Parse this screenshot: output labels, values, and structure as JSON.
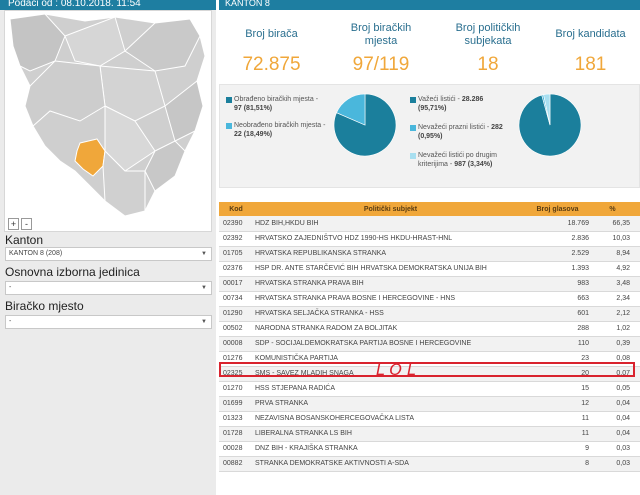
{
  "left_panel": {
    "header": "Podaci od : 08.10.2018. 11:54",
    "zoom_in": "+",
    "zoom_out": "-",
    "kanton_label": "Kanton",
    "kanton_value": "KANTON 8 (208)",
    "jedinica_label": "Osnovna izborna jedinica",
    "jedinica_value": "-",
    "mjesto_label": "Biračko mjesto",
    "mjesto_value": "-"
  },
  "right_panel": {
    "header": "KANTON 8",
    "stats": [
      {
        "label": "Broj birača",
        "value": "72.875"
      },
      {
        "label": "Broj biračkih mjesta",
        "value": "97/119"
      },
      {
        "label": "Broj političkih subjekata",
        "value": "18"
      },
      {
        "label": "Broj kandidata",
        "value": "181"
      }
    ],
    "pie1": {
      "legend": [
        {
          "label": "Obrađeno biračkih mjesta -",
          "value": "97 (81,51%)",
          "color": "#1b7f9c"
        },
        {
          "label": "Neobrađeno biračkih mjesta -",
          "value": "22 (18,49%)",
          "color": "#4ab7dc"
        }
      ],
      "fractions": [
        0.8151,
        0.1849
      ]
    },
    "pie2": {
      "legend": [
        {
          "label": "Važeći listići -",
          "value": "28.286",
          "extra": "(95,71%)",
          "color": "#1b7f9c"
        },
        {
          "label": "Nevažeći prazni listići -",
          "value": "282",
          "extra": "(0,95%)",
          "color": "#4ab7dc"
        },
        {
          "label": "Nevažeći listići po drugim",
          "label2": "kriterijima -",
          "value": "987 (3,34%)",
          "color": "#a8dff0"
        }
      ],
      "fractions": [
        0.9571,
        0.0095,
        0.0334
      ]
    }
  },
  "table": {
    "headers": {
      "kod": "Kod",
      "subjekt": "Politički subjekt",
      "glasova": "Broj glasova",
      "pct": "%"
    },
    "rows": [
      {
        "kod": "02390",
        "subjekt": "HDZ BIH,HKDU BIH",
        "glasova": "18.769",
        "pct": "66,35"
      },
      {
        "kod": "02392",
        "subjekt": "HRVATSKO ZAJEDNIŠTVO HDZ 1990-HS HKDU-HRAST-HNL",
        "glasova": "2.836",
        "pct": "10,03"
      },
      {
        "kod": "01705",
        "subjekt": "HRVATSKA REPUBLIKANSKA STRANKA",
        "glasova": "2.529",
        "pct": "8,94"
      },
      {
        "kod": "02376",
        "subjekt": "HSP DR. ANTE STARČEVIĆ BIH HRVATSKA DEMOKRATSKA UNIJA BIH",
        "glasova": "1.393",
        "pct": "4,92"
      },
      {
        "kod": "00017",
        "subjekt": "HRVATSKA STRANKA PRAVA BIH",
        "glasova": "983",
        "pct": "3,48"
      },
      {
        "kod": "00734",
        "subjekt": "HRVATSKA STRANKA PRAVA BOSNE I HERCEGOVINE - HNS",
        "glasova": "663",
        "pct": "2,34"
      },
      {
        "kod": "01290",
        "subjekt": "HRVATSKA SELJAČKA STRANKA - HSS",
        "glasova": "601",
        "pct": "2,12"
      },
      {
        "kod": "00502",
        "subjekt": "NARODNA STRANKA RADOM ZA BOLJITAK",
        "glasova": "288",
        "pct": "1,02"
      },
      {
        "kod": "00008",
        "subjekt": "SDP - SOCIJALDEMOKRATSKA PARTIJA BOSNE I HERCEGOVINE",
        "glasova": "110",
        "pct": "0,39"
      },
      {
        "kod": "01276",
        "subjekt": "KOMUNISTIČKA PARTIJA",
        "glasova": "23",
        "pct": "0,08"
      },
      {
        "kod": "02325",
        "subjekt": "SMS - SAVEZ MLADIH SNAGA",
        "glasova": "20",
        "pct": "0,07"
      },
      {
        "kod": "01270",
        "subjekt": "HSS STJEPANA RADIĆA",
        "glasova": "15",
        "pct": "0,05"
      },
      {
        "kod": "01699",
        "subjekt": "PRVA STRANKA",
        "glasova": "12",
        "pct": "0,04"
      },
      {
        "kod": "01323",
        "subjekt": "NEZAVISNA BOSANSKOHERCEGOVAČKA LISTA",
        "glasova": "11",
        "pct": "0,04"
      },
      {
        "kod": "01728",
        "subjekt": "LIBERALNA STRANKA LS BIH",
        "glasova": "11",
        "pct": "0,04"
      },
      {
        "kod": "00028",
        "subjekt": "DNZ BIH - KRAJIŠKA STRANKA",
        "glasova": "9",
        "pct": "0,03"
      },
      {
        "kod": "00882",
        "subjekt": "STRANKA DEMOKRATSKE AKTIVNOSTI A-SDA",
        "glasova": "8",
        "pct": "0,03"
      }
    ]
  },
  "annotation": {
    "text": "LOL",
    "color": "#d9232e"
  }
}
